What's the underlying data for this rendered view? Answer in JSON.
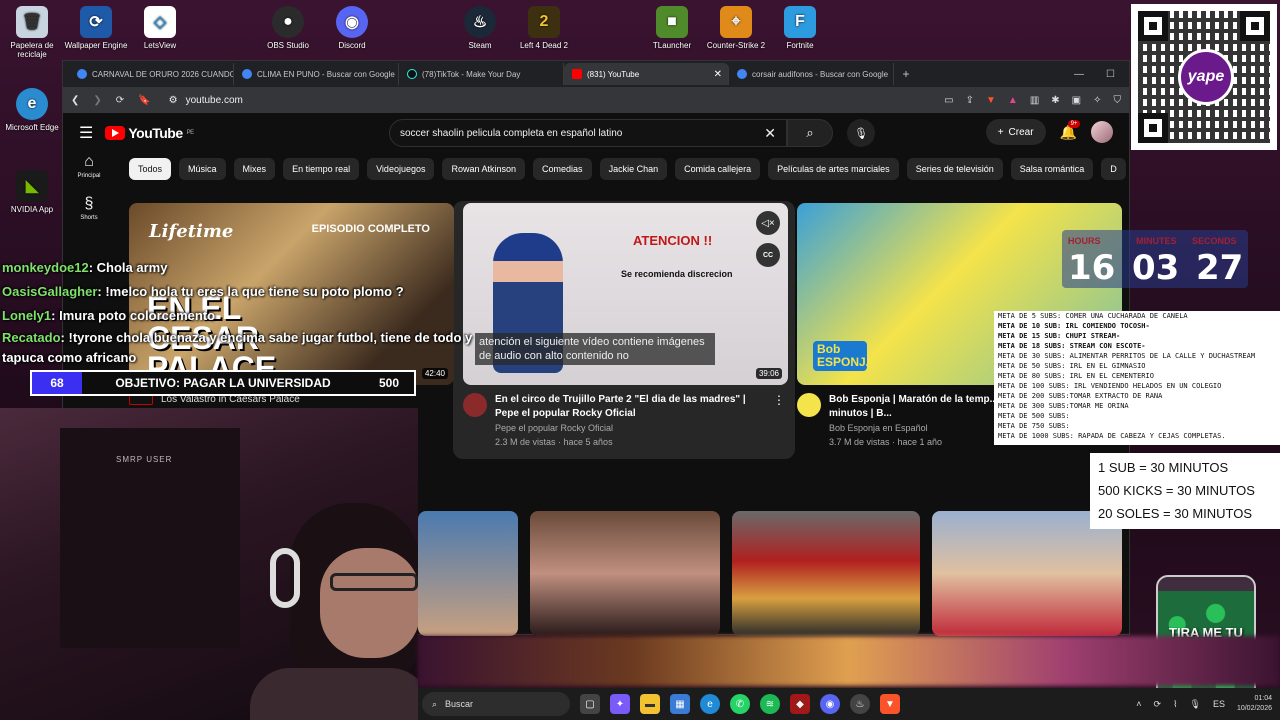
{
  "desktop": {
    "icons": [
      {
        "label": "Papelera de reciclaje",
        "color": "#c8d4e0",
        "glyph": "🗑"
      },
      {
        "label": "Wallpaper Engine",
        "color": "#1e5aa8",
        "glyph": "⟳"
      },
      {
        "label": "LetsView",
        "color": "#ffffff",
        "glyph": "◇"
      },
      {
        "label": "OBS Studio",
        "color": "#2b2b2b",
        "glyph": "●"
      },
      {
        "label": "Discord",
        "color": "#5865f2",
        "glyph": "◉"
      },
      {
        "label": "Steam",
        "color": "#1b2838",
        "glyph": "♨"
      },
      {
        "label": "Left 4 Dead 2",
        "color": "#3d3010",
        "glyph": "2"
      },
      {
        "label": "TLauncher",
        "color": "#4f8a2b",
        "glyph": "■"
      },
      {
        "label": "Counter-Strike 2",
        "color": "#e08a1a",
        "glyph": "⌖"
      },
      {
        "label": "Fortnite",
        "color": "#2d9be0",
        "glyph": "F"
      },
      {
        "label": "Microsoft Edge",
        "color": "#2a8cd0",
        "glyph": "e"
      },
      {
        "label": "NVIDIA App",
        "color": "#76b900",
        "glyph": "◣"
      }
    ]
  },
  "qr": {
    "brand": "yape"
  },
  "browser": {
    "tabs": [
      {
        "title": "CARNAVAL DE ORURO 2026 CUANDO",
        "fav": "#4285f4"
      },
      {
        "title": "CLIMA EN PUNO - Buscar con Google",
        "fav": "#4285f4"
      },
      {
        "title": "(78)TikTok - Make Your Day",
        "fav": "#111111"
      },
      {
        "title": "(831) YouTube",
        "fav": "#ff0000"
      },
      {
        "title": "corsair audifonos - Buscar con Google",
        "fav": "#4285f4"
      }
    ],
    "url": "youtube.com"
  },
  "youtube": {
    "logo": "YouTube",
    "region": "PE",
    "search_query": "soccer shaolin pelicula completa en español latino",
    "create_label": "Crear",
    "notif_count": "9+",
    "sidebar": [
      {
        "label": "Principal",
        "icon": "⌂"
      },
      {
        "label": "Shorts",
        "icon": "§"
      }
    ],
    "chips": [
      "Todos",
      "Música",
      "Mixes",
      "En tiempo real",
      "Videojuegos",
      "Rowan Atkinson",
      "Comedias",
      "Jackie Chan",
      "Comida callejera",
      "Películas de artes marciales",
      "Series de televisión",
      "Salsa romántica",
      "D"
    ],
    "videos": [
      {
        "title": "Los Valastro in Caesars Palace",
        "channel": "",
        "stats": "",
        "duration": "42:40",
        "thumb_text": "EN EL CESAR PALACE",
        "thumb_brand": "Lifetime",
        "thumb_tag": "EPISODIO COMPLETO"
      },
      {
        "title": "En el circo de Trujillo Parte 2 \"El dia de las madres\" | Pepe el popular Rocky Oficial",
        "channel": "Pepe el popular Rocky Oficial",
        "stats": "2.3 M de vistas · hace 5 años",
        "duration": "39:06",
        "thumb_text": "ATENCION !!",
        "thumb_sub": "Se recomienda discrecion",
        "caption": "atención el siguiente vídeo contiene imágenes de audio con alto contenido no"
      },
      {
        "title": "Bob Esponja | Maratón de la temp... | Compilación de 52 minutos | B...",
        "channel": "Bob Esponja en Español",
        "stats": "3.7 M de vistas · hace 1 año",
        "duration": "",
        "thumb_text": "Bob ESPONJA"
      }
    ]
  },
  "stream": {
    "chat": [
      {
        "user": "monkeydoe12",
        "msg": "Chola army"
      },
      {
        "user": "OasisGallagher",
        "msg": "!melco hola tu eres la que tiene su poto plomo ?"
      },
      {
        "user": "Lonely1",
        "msg": "Imura poto colorcemento"
      },
      {
        "user": "Recatado",
        "msg": "!tyrone chola buenaza y encima sabe jugar futbol, tiene de todo y tapuca como africano"
      }
    ],
    "goal": {
      "current": "68",
      "label": "OBJETIVO: PAGAR LA UNIVERSIDAD",
      "target": "500",
      "progress": 0.136
    },
    "cam_sign": "SMRP USER",
    "timer": {
      "hours_label": "HOURS",
      "minutes_label": "MINUTES",
      "seconds_label": "SECONDS",
      "hours": "16",
      "minutes": "03",
      "seconds": "27"
    },
    "meta_goals": [
      {
        "t": "META DE 5 SUBS: COMER UNA CUCHARADA DE CANELA",
        "b": false
      },
      {
        "t": "META DE 10 SUB: IRL COMIENDO TOCOSH-",
        "b": true
      },
      {
        "t": "META DE 15 SUB: CHUPI STREAM-",
        "b": true
      },
      {
        "t": "META DE 18 SUBS: STREAM CON ESCOTE-",
        "b": true
      },
      {
        "t": "META DE 30 SUBS:  ALIMENTAR PERRITOS DE LA CALLE Y DUCHASTREAM",
        "b": false
      },
      {
        "t": "META DE 50 SUBS: IRL EN EL GIMNASIO",
        "b": false
      },
      {
        "t": "META DE 80 SUBS: IRL EN EL CEMENTERIO",
        "b": false
      },
      {
        "t": "META DE 100 SUBS: IRL VENDIENDO HELADOS EN UN COLEGIO",
        "b": false
      },
      {
        "t": "META DE 200 SUBS:TOMAR EXTRACTO DE RANA",
        "b": false
      },
      {
        "t": "META DE 300 SUBS:TOMAR ME ORINA",
        "b": false
      },
      {
        "t": "META DE 500 SUBS:",
        "b": false
      },
      {
        "t": "META DE 750 SUBS:",
        "b": false
      },
      {
        "t": "META DE 1000 SUBS: RAPADA DE CABEZA Y CEJAS COMPLETAS.",
        "b": false
      }
    ],
    "rates": [
      "1 SUB = 30 MINUTOS",
      "500 KICKS = 30 MINUTOS",
      "20 SOLES = 30 MINUTOS"
    ],
    "jar_text": "TIRA ME TU PLATA"
  },
  "taskbar": {
    "search": "Buscar",
    "apps": [
      {
        "name": "task-view",
        "color": "#444",
        "g": "▢"
      },
      {
        "name": "copilot",
        "color": "#7a5af8",
        "g": "✦"
      },
      {
        "name": "explorer",
        "color": "#f2c230",
        "g": "▬"
      },
      {
        "name": "store",
        "color": "#3a7bd5",
        "g": "▦"
      },
      {
        "name": "edge",
        "color": "#1f8ad6",
        "g": "e"
      },
      {
        "name": "whatsapp",
        "color": "#25d366",
        "g": "✆"
      },
      {
        "name": "spotify",
        "color": "#1db954",
        "g": "≋"
      },
      {
        "name": "app-red",
        "color": "#a01818",
        "g": "◆"
      },
      {
        "name": "discord",
        "color": "#5865f2",
        "g": "◉"
      },
      {
        "name": "steam",
        "color": "#444",
        "g": "♨"
      },
      {
        "name": "brave",
        "color": "#fb542b",
        "g": "▼"
      }
    ],
    "lang": "ES",
    "time": "01:04",
    "date": "10/02/2026"
  }
}
